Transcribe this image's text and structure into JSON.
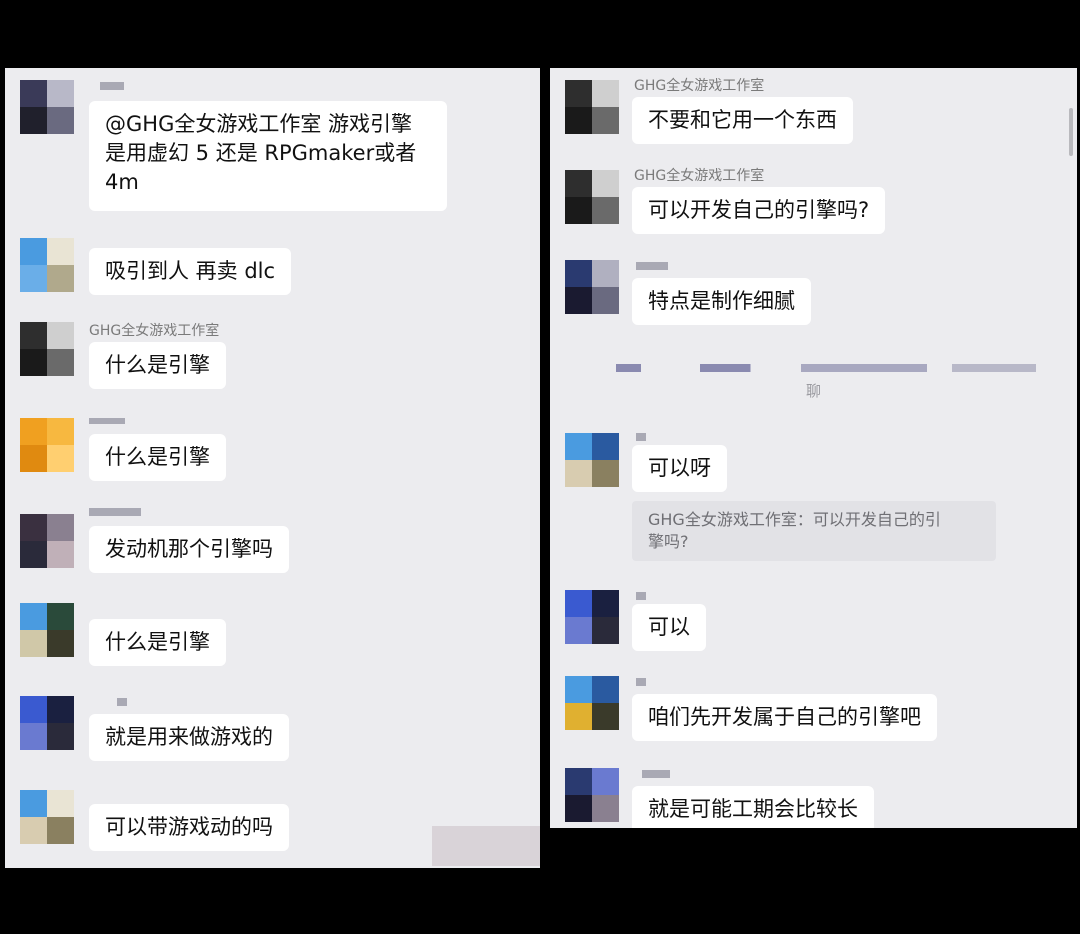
{
  "left_panel": {
    "messages": [
      {
        "sender": "",
        "text_lines": [
          "@GHG全女游戏工作室 游戏引擎",
          "是用虚幻 5 还是 RPGmaker或者",
          "4m"
        ]
      },
      {
        "sender": "",
        "text": "吸引到人 再卖 dlc"
      },
      {
        "sender": "GHG全女游戏工作室",
        "text": "什么是引擎"
      },
      {
        "sender": "",
        "text": "什么是引擎"
      },
      {
        "sender": "",
        "text": "发动机那个引擎吗"
      },
      {
        "sender": "",
        "text": "什么是引擎"
      },
      {
        "sender": "",
        "text": "就是用来做游戏的"
      },
      {
        "sender": "",
        "text": "可以带游戏动的吗"
      }
    ]
  },
  "right_panel": {
    "messages": [
      {
        "sender": "GHG全女游戏工作室",
        "text": "不要和它用一个东西"
      },
      {
        "sender": "GHG全女游戏工作室",
        "text": "可以开发自己的引擎吗?"
      },
      {
        "sender": "",
        "text": "特点是制作细腻"
      },
      {
        "sender": "",
        "text": "可以呀",
        "quote_lines": [
          "GHG全女游戏工作室：可以开发自己的引",
          "擎吗?"
        ]
      },
      {
        "sender": "",
        "text": "可以"
      },
      {
        "sender": "",
        "text": "咱们先开发属于自己的引擎吧"
      },
      {
        "sender": "",
        "text": "就是可能工期会比较长"
      }
    ],
    "system_line": "聊"
  },
  "avatar_colors": {
    "photo": [
      "#2e2e2e",
      "#cfcfcf",
      "#1a1a1a",
      "#6a6a6a"
    ],
    "blue_pixel": [
      "#4a9be0",
      "#e9e4d4",
      "#6aaee8",
      "#b0a98c"
    ],
    "orange": [
      "#f0a020",
      "#f7b840",
      "#e08a10",
      "#ffcf70"
    ],
    "dark_mosaic": [
      "#3a3040",
      "#8a8090",
      "#2a2a3a",
      "#c0b0b8"
    ],
    "blue_dark": [
      "#3a5ad0",
      "#1a2040",
      "#6a7ad0",
      "#2a2a3a"
    ]
  }
}
